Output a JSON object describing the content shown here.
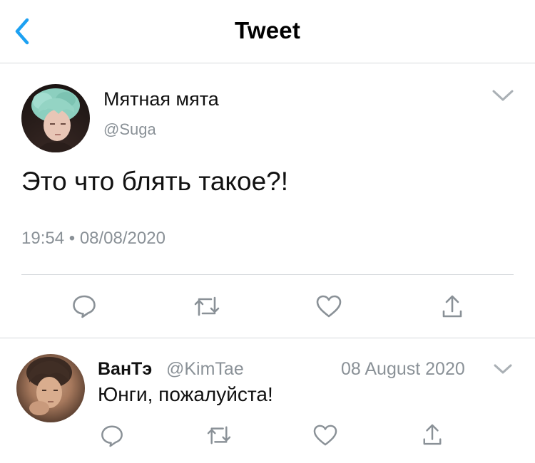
{
  "header": {
    "title": "Tweet",
    "back_icon": "chevron-left-icon",
    "accent_color": "#1da1f2"
  },
  "tweet": {
    "author_name": "Мятная мята",
    "author_handle": "@Suga",
    "text": "Это что блять такое?!",
    "time": "19:54",
    "separator": "•",
    "date": "08/08/2020",
    "menu_icon": "chevron-down-icon",
    "actions": [
      "reply-icon",
      "retweet-icon",
      "like-icon",
      "share-icon"
    ]
  },
  "reply": {
    "author_name": "ВанТэ",
    "author_handle": "@KimTae",
    "date": "08 August 2020",
    "text": "Юнги, пожалуйста!",
    "menu_icon": "chevron-down-icon",
    "actions": [
      "reply-icon",
      "retweet-icon",
      "like-icon",
      "share-icon"
    ]
  },
  "colors": {
    "secondary_text": "#8a9197",
    "divider": "#d6d9dc",
    "icon": "#8a9197"
  }
}
